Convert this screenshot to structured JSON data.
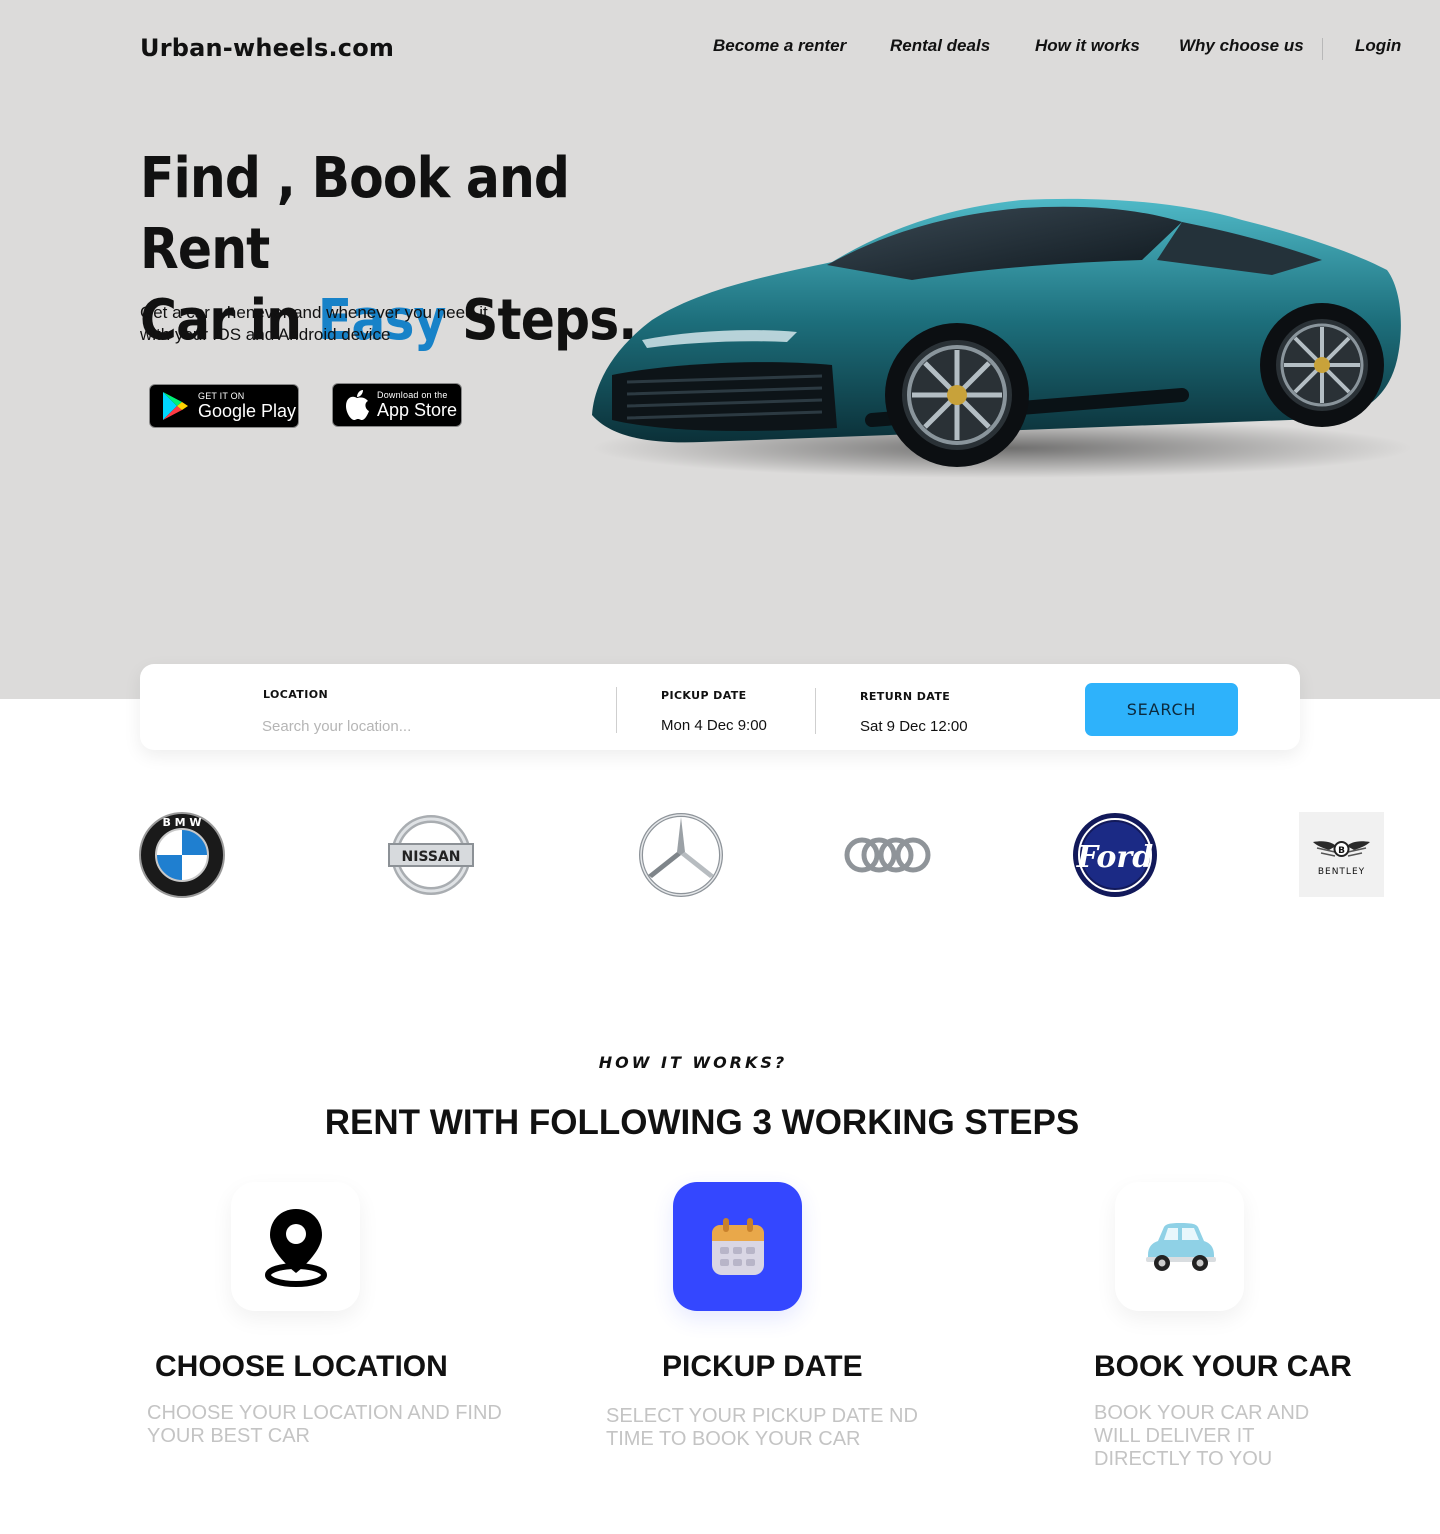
{
  "brand": {
    "name": "Urban-wheels.com"
  },
  "nav": {
    "items": [
      "Become a renter",
      "Rental deals",
      "How it works",
      "Why choose us"
    ],
    "login": "Login"
  },
  "hero": {
    "title_line1": "Find , Book and Rent",
    "title_line2_prefix": "Car in ",
    "title_accent": "Easy",
    "title_line2_suffix": " Steps.",
    "subtitle": "Get a car whenever and whenever you need it with your iOS and Android device",
    "google_play": {
      "small": "GET IT ON",
      "big": "Google Play"
    },
    "app_store": {
      "small": "Download on the",
      "big": "App Store"
    }
  },
  "search": {
    "location_label": "LOCATION",
    "location_placeholder": "Search your location...",
    "pickup_label": "PICKUP DATE",
    "pickup_value": "Mon 4 Dec 9:00",
    "return_label": "RETURN DATE",
    "return_value": "Sat 9 Dec 12:00",
    "button": "SEARCH"
  },
  "brands": {
    "bmw": "B M W",
    "nissan": "NISSAN",
    "ford": "Ford",
    "bentley": "BENTLEY"
  },
  "how_it_works": {
    "eyebrow": "HOW IT WORKS?",
    "title": "RENT WITH FOLLOWING 3 WORKING STEPS",
    "steps": [
      {
        "icon": "map-pin-icon",
        "title": "CHOOSE LOCATION",
        "desc": "CHOOSE YOUR LOCATION AND FIND YOUR BEST CAR"
      },
      {
        "icon": "calendar-icon",
        "title": "PICKUP DATE",
        "desc": "SELECT YOUR PICKUP DATE ND TIME TO BOOK YOUR CAR"
      },
      {
        "icon": "car-icon",
        "title": "BOOK YOUR CAR",
        "desc": "BOOK YOUR CAR AND WILL DELIVER IT DIRECTLY TO YOU"
      }
    ]
  },
  "colors": {
    "hero_bg": "#dcdbda",
    "accent": "#1782c8",
    "search_button": "#2eb2fb",
    "step_highlight": "#3447ff"
  }
}
